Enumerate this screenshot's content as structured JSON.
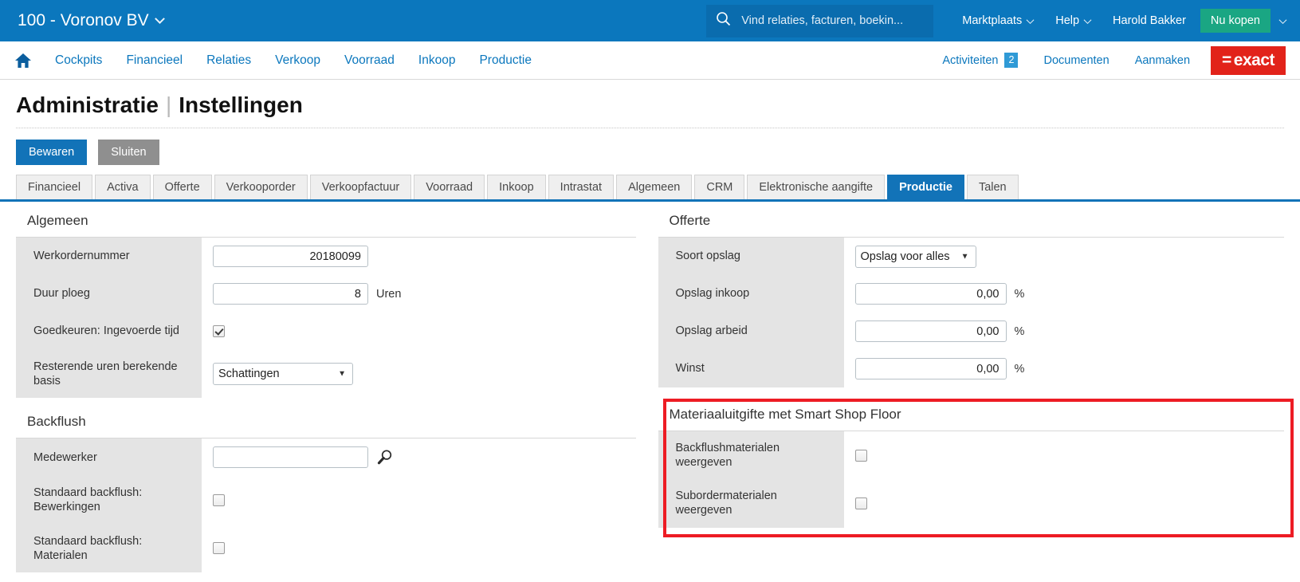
{
  "topbar": {
    "administration": "100 - Voronov BV",
    "search": {
      "placeholder": "Vind relaties, facturen, boekin...",
      "value": "",
      "icon": "search-icon"
    },
    "links": [
      {
        "label": "Marktplaats",
        "caret": true
      },
      {
        "label": "Help",
        "caret": true
      },
      {
        "label": "Harold Bakker",
        "caret": false
      }
    ],
    "buy_button": "Nu kopen",
    "colors": {
      "bar": "#0b77bd",
      "search_bg": "#0a6cae",
      "buy": "#1aa683"
    }
  },
  "mainnav": {
    "home_icon": "home-icon",
    "items": [
      "Cockpits",
      "Financieel",
      "Relaties",
      "Verkoop",
      "Voorraad",
      "Inkoop",
      "Productie"
    ],
    "right_items": [
      {
        "label": "Activiteiten",
        "badge": "2"
      },
      {
        "label": "Documenten",
        "badge": ""
      },
      {
        "label": "Aanmaken",
        "badge": ""
      }
    ],
    "logo": {
      "equals": "=",
      "name": "exact",
      "color": "#e2231a"
    }
  },
  "page": {
    "title_main": "Administratie",
    "title_sep": "|",
    "title_sub": "Instellingen"
  },
  "actions": {
    "save_label": "Bewaren",
    "close_label": "Sluiten"
  },
  "tabs": [
    {
      "label": "Financieel",
      "active": false
    },
    {
      "label": "Activa",
      "active": false
    },
    {
      "label": "Offerte",
      "active": false
    },
    {
      "label": "Verkooporder",
      "active": false
    },
    {
      "label": "Verkoopfactuur",
      "active": false
    },
    {
      "label": "Voorraad",
      "active": false
    },
    {
      "label": "Inkoop",
      "active": false
    },
    {
      "label": "Intrastat",
      "active": false
    },
    {
      "label": "Algemeen",
      "active": false
    },
    {
      "label": "CRM",
      "active": false
    },
    {
      "label": "Elektronische aangifte",
      "active": false
    },
    {
      "label": "Productie",
      "active": true
    },
    {
      "label": "Talen",
      "active": false
    }
  ],
  "sections": {
    "algemeen": {
      "title": "Algemeen",
      "rows": {
        "werkordernummer": {
          "label": "Werkordernummer",
          "value": "20180099"
        },
        "duur_ploeg": {
          "label": "Duur ploeg",
          "value": "8",
          "unit": "Uren"
        },
        "goedkeuren": {
          "label": "Goedkeuren: Ingevoerde tijd",
          "checked": true
        },
        "resterende": {
          "label": "Resterende uren berekende basis",
          "value": "Schattingen",
          "options": [
            "Schattingen"
          ]
        }
      }
    },
    "backflush": {
      "title": "Backflush",
      "rows": {
        "medewerker": {
          "label": "Medewerker",
          "value": "",
          "icon": "magnifier-icon"
        },
        "bewerkingen": {
          "label": "Standaard backflush: Bewerkingen",
          "checked": false
        },
        "materialen": {
          "label": "Standaard backflush: Materialen",
          "checked": false
        }
      }
    },
    "offerte": {
      "title": "Offerte",
      "rows": {
        "soort_opslag": {
          "label": "Soort opslag",
          "value": "Opslag voor alles",
          "options": [
            "Opslag voor alles"
          ]
        },
        "opslag_inkoop": {
          "label": "Opslag inkoop",
          "value": "0,00",
          "unit": "%"
        },
        "opslag_arbeid": {
          "label": "Opslag arbeid",
          "value": "0,00",
          "unit": "%"
        },
        "winst": {
          "label": "Winst",
          "value": "0,00",
          "unit": "%"
        }
      }
    },
    "smart_shop_floor": {
      "title": "Materiaaluitgifte met Smart Shop Floor",
      "highlight_color": "#ed1c24",
      "rows": {
        "backflushmaterialen": {
          "label": "Backflushmaterialen weergeven",
          "checked": false
        },
        "subordermaterialen": {
          "label": "Subordermaterialen weergeven",
          "checked": false
        }
      }
    }
  }
}
